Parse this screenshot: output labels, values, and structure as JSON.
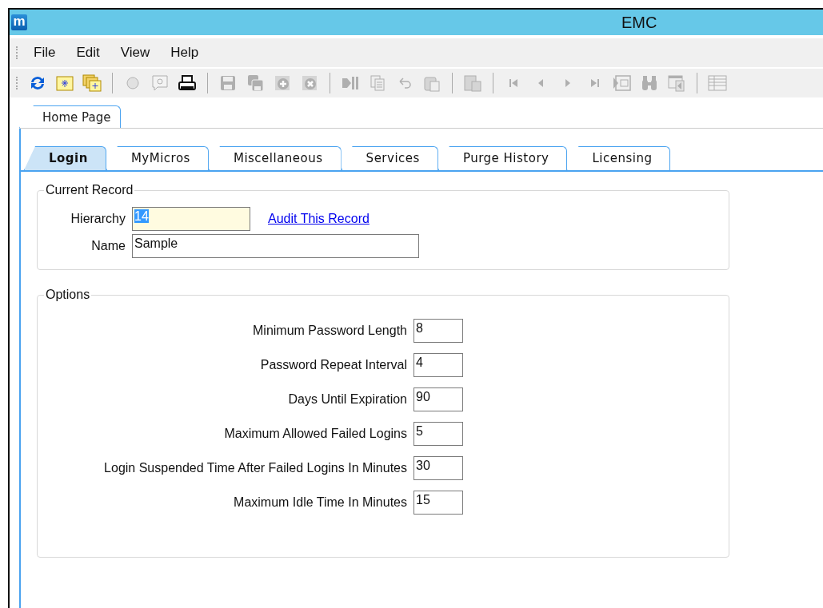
{
  "window": {
    "title": "EMC",
    "app_icon": "m"
  },
  "menu": [
    "File",
    "Edit",
    "View",
    "Help"
  ],
  "toolbar": [
    {
      "kind": "refresh",
      "disabled": false
    },
    {
      "kind": "folder",
      "disabled": false
    },
    {
      "kind": "folders",
      "disabled": false
    },
    {
      "kind": "sep"
    },
    {
      "kind": "circle",
      "disabled": true
    },
    {
      "kind": "speech",
      "disabled": true
    },
    {
      "kind": "printer",
      "disabled": false
    },
    {
      "kind": "sep"
    },
    {
      "kind": "save",
      "disabled": true
    },
    {
      "kind": "saveall",
      "disabled": true
    },
    {
      "kind": "add",
      "disabled": true
    },
    {
      "kind": "delete",
      "disabled": true
    },
    {
      "kind": "sep"
    },
    {
      "kind": "insert",
      "disabled": true
    },
    {
      "kind": "copy",
      "disabled": true
    },
    {
      "kind": "undo",
      "disabled": true
    },
    {
      "kind": "paste",
      "disabled": true
    },
    {
      "kind": "sep"
    },
    {
      "kind": "grid",
      "disabled": true
    },
    {
      "kind": "sep"
    },
    {
      "kind": "first",
      "disabled": true
    },
    {
      "kind": "prev",
      "disabled": true
    },
    {
      "kind": "next",
      "disabled": true
    },
    {
      "kind": "last",
      "disabled": true
    },
    {
      "kind": "goto",
      "disabled": true
    },
    {
      "kind": "binoculars",
      "disabled": true
    },
    {
      "kind": "window",
      "disabled": true
    },
    {
      "kind": "sep"
    },
    {
      "kind": "table",
      "disabled": true
    }
  ],
  "document_tabs": [
    {
      "label": "Home Page",
      "selected": true
    }
  ],
  "tabs": [
    {
      "label": "Login",
      "selected": true
    },
    {
      "label": "MyMicros",
      "selected": false
    },
    {
      "label": "Miscellaneous",
      "selected": false
    },
    {
      "label": "Services",
      "selected": false
    },
    {
      "label": "Purge History",
      "selected": false
    },
    {
      "label": "Licensing",
      "selected": false
    }
  ],
  "current_record": {
    "title": "Current Record",
    "hierarchy": {
      "label": "Hierarchy",
      "value": "14",
      "text_selected": true
    },
    "audit_link": "Audit This Record",
    "name": {
      "label": "Name",
      "value": "Sample"
    }
  },
  "options": {
    "title": "Options",
    "fields": [
      {
        "label": "Minimum Password Length",
        "value": "8"
      },
      {
        "label": "Password Repeat Interval",
        "value": "4"
      },
      {
        "label": "Days Until Expiration",
        "value": "90"
      },
      {
        "label": "Maximum Allowed Failed Logins",
        "value": "5"
      },
      {
        "label": "Login Suspended Time After Failed Logins In Minutes",
        "value": "30"
      },
      {
        "label": "Maximum Idle Time In Minutes",
        "value": "15"
      }
    ]
  }
}
